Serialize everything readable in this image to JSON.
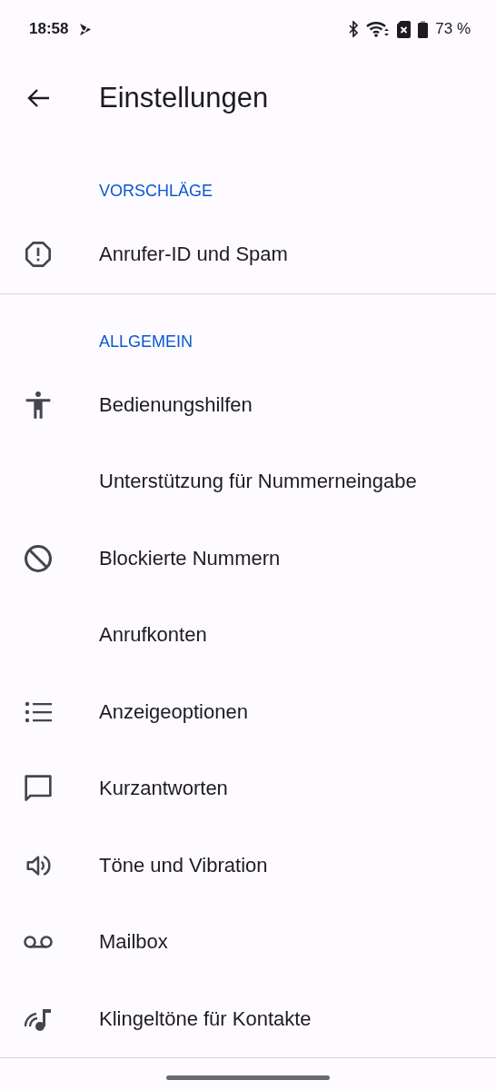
{
  "status_bar": {
    "time": "18:58",
    "battery": "73 %"
  },
  "header": {
    "title": "Einstellungen"
  },
  "sections": [
    {
      "title": "VORSCHLÄGE",
      "items": [
        {
          "label": "Anrufer-ID und Spam",
          "kind": "spam"
        }
      ]
    },
    {
      "title": "ALLGEMEIN",
      "items": [
        {
          "label": "Bedienungshilfen",
          "kind": "accessibility"
        },
        {
          "label": "Unterstützung für Nummerneingabe",
          "kind": "plain"
        },
        {
          "label": "Blockierte Nummern",
          "kind": "blocked"
        },
        {
          "label": "Anrufkonten",
          "kind": "plain"
        },
        {
          "label": "Anzeigeoptionen",
          "kind": "list"
        },
        {
          "label": "Kurzantworten",
          "kind": "message"
        },
        {
          "label": "Töne und Vibration",
          "kind": "sound"
        },
        {
          "label": "Mailbox",
          "kind": "voicemail"
        },
        {
          "label": "Klingeltöne für Kontakte",
          "kind": "ringtone"
        }
      ]
    }
  ]
}
